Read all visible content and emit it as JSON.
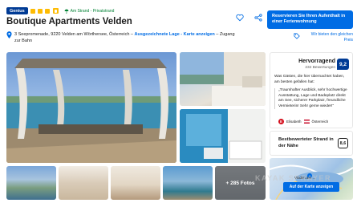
{
  "header": {
    "genius_badge": "Genius",
    "beach_badge": "Am Strand - Privatstrand",
    "title": "Boutique Apartments Velden",
    "address": "3 Seepromenade, 9220 Velden am Wörthersee, Österreich –",
    "location_link": "Ausgezeichnete Lage - Karte anzeigen",
    "address_tail": "– Zugang zur Bahn",
    "reserve_button": "Reservieren Sie Ihren Aufenthalt in einer Ferienwohnung",
    "price_match": "Wir bieten den gleichen Preis"
  },
  "gallery": {
    "more_photos": "+ 285 Fotos"
  },
  "review": {
    "label": "Hervorragend",
    "count": "232 Bewertungen",
    "score": "9,2",
    "intro": "Was Gästen, die hier übernachtet haben, am besten gefallen hat:",
    "quote": "„Traumhafter Ausblick, sehr hochwertige Ausstattung, Lage und Badeplatz direkt am See, sicherer Parkplatz, freundliche Vermieterin! Sehr gerne wieder!\"",
    "reviewer_initial": "E",
    "reviewer_name": "Elisabeth",
    "reviewer_country": "Österreich"
  },
  "beach": {
    "label": "Bestbewerteter Strand in der Nähe",
    "score": "8,6"
  },
  "map": {
    "place_label": "Velden am ...",
    "button": "Auf der Karte anzeigen"
  },
  "watermark": "KAYAK SPRAYER",
  "colors": {
    "brand_blue": "#006ce4",
    "dark_blue": "#003b95",
    "beach_green": "#008234",
    "star_yellow": "#febb02"
  }
}
